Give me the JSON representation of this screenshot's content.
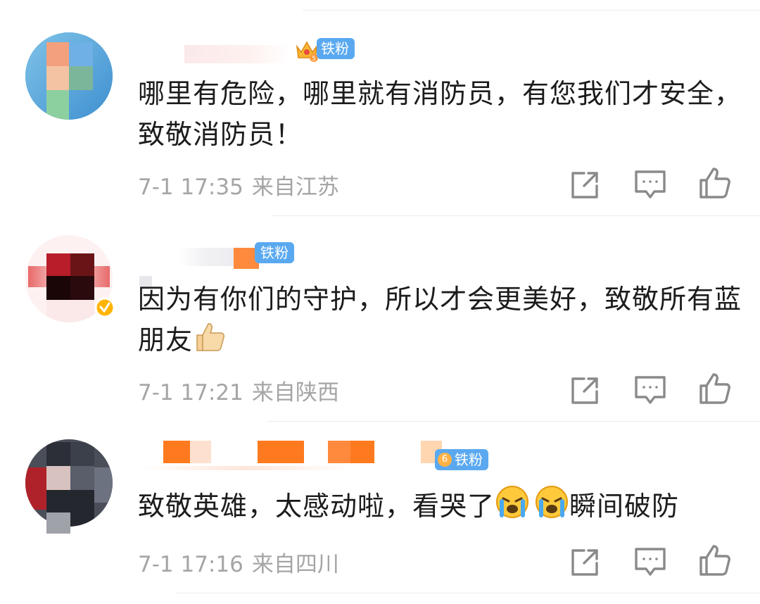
{
  "comments": [
    {
      "badge": "铁粉",
      "badge_level": "5",
      "text": "哪里有危险，哪里就有消防员，有您我们才安全，致敬消防员！",
      "time": "7-1 17:35",
      "location": "来自江苏"
    },
    {
      "badge": "铁粉",
      "text": "因为有你们的守护，所以才会更美好，致敬所有蓝朋友",
      "time": "7-1 17:21",
      "location": "来自陕西"
    },
    {
      "badge": "铁粉",
      "badge_level": "6",
      "text_before": "致敬英雄，太感动啦，看哭了",
      "text_after": "瞬间破防",
      "time": "7-1 17:16",
      "location": "来自四川"
    }
  ],
  "icons": {
    "share": "share-icon",
    "comment": "comment-icon",
    "like": "thumbs-up-icon",
    "verified": "verified-icon",
    "emoji_thumbs": "thumbs-up-emoji",
    "emoji_cry": "crying-emoji"
  },
  "colors": {
    "badge": "#5aa9f0",
    "meta_text": "#a5a5a5",
    "body_text": "#1c1c1c",
    "icon": "#8a8a8a"
  }
}
